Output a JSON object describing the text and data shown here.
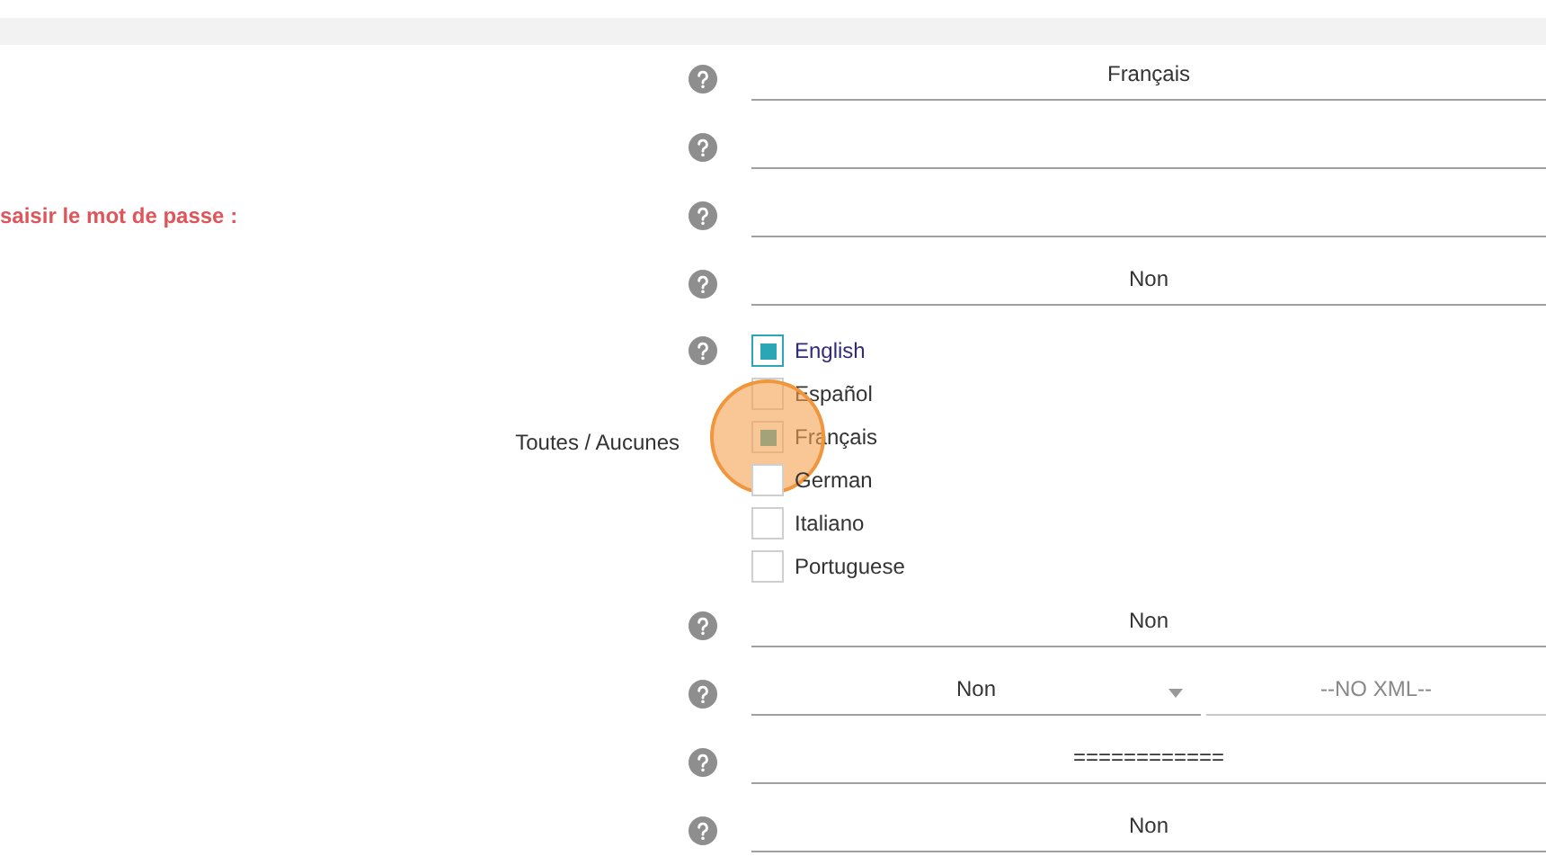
{
  "rows": [
    {
      "kind": "select",
      "value": "Français"
    },
    {
      "kind": "text",
      "value": ""
    },
    {
      "kind": "password",
      "label": "saisir le mot de passe :",
      "error": true
    },
    {
      "kind": "select",
      "value": "Non"
    },
    {
      "kind": "checklist",
      "label": "Toutes / Aucunes",
      "options": [
        {
          "label": "English",
          "checked": true,
          "focused": true,
          "highlighted": false
        },
        {
          "label": "Español",
          "checked": false,
          "focused": false,
          "highlighted": false
        },
        {
          "label": "Français",
          "checked": true,
          "focused": false,
          "highlighted": true
        },
        {
          "label": "German",
          "checked": false,
          "focused": false,
          "highlighted": false
        },
        {
          "label": "Italiano",
          "checked": false,
          "focused": false,
          "highlighted": false
        },
        {
          "label": "Portuguese",
          "checked": false,
          "focused": false,
          "highlighted": false
        }
      ]
    },
    {
      "kind": "select",
      "value": "Non"
    },
    {
      "kind": "select_pair",
      "value": "Non",
      "second_value": "--NO XML--"
    },
    {
      "kind": "select",
      "value": "============"
    },
    {
      "kind": "select",
      "value": "Non"
    }
  ]
}
